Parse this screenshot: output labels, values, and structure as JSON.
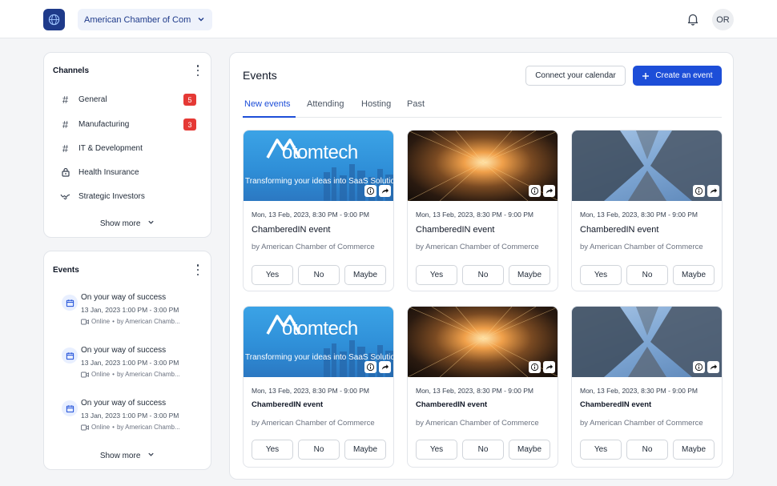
{
  "header": {
    "org_name": "American Chamber of Com...",
    "avatar_initials": "OR"
  },
  "channels": {
    "title": "Channels",
    "items": [
      {
        "label": "General",
        "icon": "hash-icon",
        "badge": "5"
      },
      {
        "label": "Manufacturing",
        "icon": "hash-icon",
        "badge": "3"
      },
      {
        "label": "IT & Development",
        "icon": "hash-icon"
      },
      {
        "label": "Health Insurance",
        "icon": "lock-icon"
      },
      {
        "label": "Strategic Investors",
        "icon": "handshake-icon"
      }
    ],
    "show_more": "Show more"
  },
  "sidebar_events": {
    "title": "Events",
    "items": [
      {
        "title": "On your way of success",
        "time": "13 Jan, 2023 1:00 PM - 3:00 PM",
        "mode": "Online",
        "host": "by American Chamb..."
      },
      {
        "title": "On your way of success",
        "time": "13 Jan, 2023 1:00 PM - 3:00 PM",
        "mode": "Online",
        "host": "by American Chamb..."
      },
      {
        "title": "On your way of success",
        "time": "13 Jan, 2023 1:00 PM - 3:00 PM",
        "mode": "Online",
        "host": "by American Chamb..."
      }
    ],
    "show_more": "Show more"
  },
  "main": {
    "title": "Events",
    "connect_calendar": "Connect your calendar",
    "create_event": "Create an event",
    "tabs": [
      "New events",
      "Attending",
      "Hosting",
      "Past"
    ],
    "banner_brand": "otomtech",
    "banner_tagline": "Transforming your ideas into SaaS Solutions",
    "cards": [
      {
        "date": "Mon, 13 Feb, 2023, 8:30 PM - 9:00 PM",
        "name": "ChamberedIN event",
        "org": "by American Chamber of Commerce",
        "image": "motomtech-banner"
      },
      {
        "date": "Mon, 13 Feb, 2023, 8:30 PM - 9:00 PM",
        "name": "ChamberedIN event",
        "org": "by American Chamber of Commerce",
        "image": "light-tunnel"
      },
      {
        "date": "Mon, 13 Feb, 2023, 8:30 PM - 9:00 PM",
        "name": "ChamberedIN event",
        "org": "by American Chamber of Commerce",
        "image": "skyscrapers"
      },
      {
        "date": "Mon, 13 Feb, 2023, 8:30 PM - 9:00 PM",
        "name": "ChamberedIN event",
        "org": "by American Chamber of Commerce",
        "image": "motomtech-banner"
      },
      {
        "date": "Mon, 13 Feb, 2023, 8:30 PM - 9:00 PM",
        "name": "ChamberedIN event",
        "org": "by American Chamber of Commerce",
        "image": "light-tunnel"
      },
      {
        "date": "Mon, 13 Feb, 2023, 8:30 PM - 9:00 PM",
        "name": "ChamberedIN event",
        "org": "by American Chamber of Commerce",
        "image": "skyscrapers"
      }
    ],
    "rsvp": {
      "yes": "Yes",
      "no": "No",
      "maybe": "Maybe"
    }
  },
  "colors": {
    "accent": "#1d4ed8",
    "badge": "#e53935",
    "logo_bg": "#1e3a8a"
  }
}
